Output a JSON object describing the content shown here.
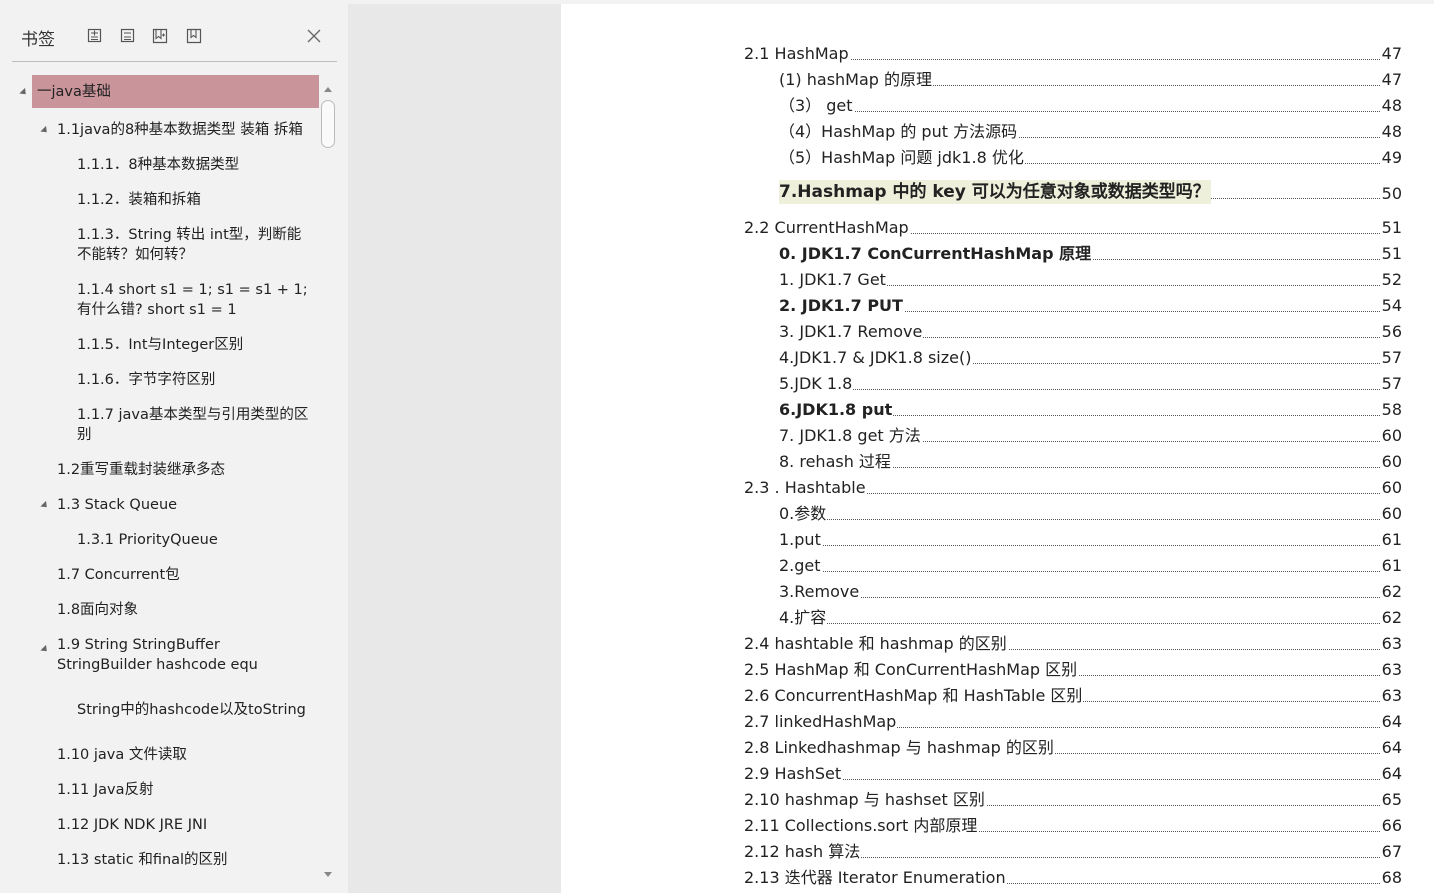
{
  "panel": {
    "title": "书签",
    "tools": [
      "expand-all-icon",
      "collapse-all-icon",
      "add-bookmark-icon",
      "bookmark-icon"
    ],
    "close_icon": "close-icon",
    "tree": [
      {
        "label": "一java基础",
        "level": 0,
        "expanded": true,
        "selected": true
      },
      {
        "label": "1.1java的8种基本数据类型 装箱 拆箱",
        "level": 1,
        "expanded": true
      },
      {
        "label": "1.1.1．8种基本数据类型",
        "level": 2
      },
      {
        "label": "1.1.2．装箱和拆箱",
        "level": 2
      },
      {
        "label": "1.1.3．String 转出 int型，判断能不能转？如何转？",
        "level": 2
      },
      {
        "label": "1.1.4 short s1 = 1; s1 = s1 + 1;有什么错? short s1 = 1",
        "level": 2
      },
      {
        "label": "1.1.5．Int与Integer区别",
        "level": 2
      },
      {
        "label": "1.1.6．字节字符区别",
        "level": 2
      },
      {
        "label": "1.1.7 java基本类型与引用类型的区别",
        "level": 2
      },
      {
        "label": "1.2重写重载封装继承多态",
        "level": 1
      },
      {
        "label": "1.3 Stack Queue",
        "level": 1,
        "expanded": true
      },
      {
        "label": "1.3.1 PriorityQueue",
        "level": 2
      },
      {
        "label": "1.7 Concurrent包",
        "level": 1
      },
      {
        "label": "1.8面向对象",
        "level": 1
      },
      {
        "label": "1.9 String StringBuffer StringBuilder hashcode equ",
        "level": 1,
        "expanded": true
      },
      {
        "label": "String中的hashcode以及toString",
        "level": 2
      },
      {
        "label": "1.10 java 文件读取",
        "level": 1
      },
      {
        "label": "1.11 Java反射",
        "level": 1
      },
      {
        "label": "1.12 JDK NDK JRE JNI",
        "level": 1
      },
      {
        "label": "1.13 static 和final的区别",
        "level": 1
      }
    ]
  },
  "toc": [
    {
      "text": "2.1 HashMap",
      "page": "47",
      "level": 0
    },
    {
      "text": "(1) hashMap 的原理",
      "page": "47",
      "level": 1
    },
    {
      "text": "（3）  get",
      "page": "48",
      "level": 1
    },
    {
      "text": "（4）HashMap 的 put 方法源码",
      "page": "48",
      "level": 1
    },
    {
      "text": "（5）HashMap 问题  jdk1.8 优化",
      "page": "49",
      "level": 1
    },
    {
      "text": "7.Hashmap 中的 key 可以为任意对象或数据类型吗？",
      "page": "50",
      "level": 1,
      "highlight": true
    },
    {
      "text": "2.2 CurrentHashMap",
      "page": "51",
      "level": 0
    },
    {
      "text": "0. JDK1.7 ConCurrentHashMap 原理",
      "page": "51",
      "level": 1,
      "bold": true
    },
    {
      "text": "1. JDK1.7 Get",
      "page": "52",
      "level": 1
    },
    {
      "text": "2. JDK1.7 PUT",
      "page": "54",
      "level": 1,
      "bold": true
    },
    {
      "text": "3. JDK1.7 Remove",
      "page": "56",
      "level": 1
    },
    {
      "text": "4.JDK1.7 & JDK1.8 size()",
      "page": "57",
      "level": 1
    },
    {
      "text": "5.JDK 1.8",
      "page": "57",
      "level": 1
    },
    {
      "text": "6.JDK1.8 put",
      "page": "58",
      "level": 1,
      "bold": true
    },
    {
      "text": "7. JDK1.8 get 方法",
      "page": "60",
      "level": 1
    },
    {
      "text": "8. rehash 过程",
      "page": "60",
      "level": 1
    },
    {
      "text": "2.3 . Hashtable",
      "page": "60",
      "level": 0
    },
    {
      "text": "0.参数",
      "page": "60",
      "level": 1
    },
    {
      "text": "1.put",
      "page": "61",
      "level": 1
    },
    {
      "text": "2.get",
      "page": "61",
      "level": 1
    },
    {
      "text": "3.Remove",
      "page": "62",
      "level": 1
    },
    {
      "text": "4.扩容",
      "page": "62",
      "level": 1
    },
    {
      "text": "2.4 hashtable 和 hashmap 的区别",
      "page": "63",
      "level": 0
    },
    {
      "text": "2.5   HashMap 和 ConCurrentHashMap 区别",
      "page": "63",
      "level": 0
    },
    {
      "text": "2.6 ConcurrentHashMap 和 HashTable 区别",
      "page": "63",
      "level": 0
    },
    {
      "text": "2.7   linkedHashMap",
      "page": "64",
      "level": 0
    },
    {
      "text": "2.8 Linkedhashmap 与  hashmap 的区别",
      "page": "64",
      "level": 0
    },
    {
      "text": "2.9 HashSet",
      "page": "64",
      "level": 0
    },
    {
      "text": "2.10 hashmap 与 hashset 区别",
      "page": "65",
      "level": 0
    },
    {
      "text": "2.11 Collections.sort  内部原理",
      "page": "66",
      "level": 0
    },
    {
      "text": "2.12 hash 算法",
      "page": "67",
      "level": 0
    },
    {
      "text": "2.13  迭代器  Iterator Enumeration",
      "page": "68",
      "level": 0
    }
  ]
}
